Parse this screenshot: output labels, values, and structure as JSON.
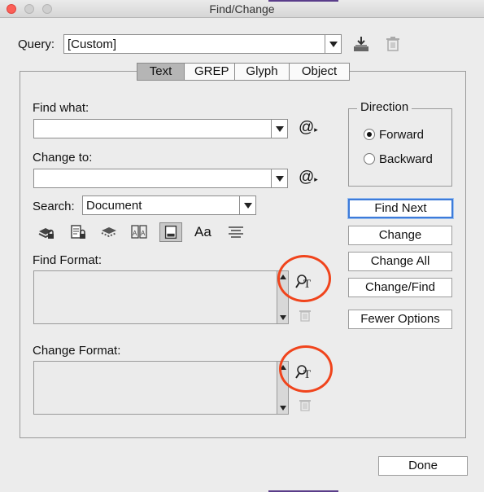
{
  "window": {
    "title": "Find/Change"
  },
  "query": {
    "label": "Query:",
    "value": "[Custom]"
  },
  "tabs": [
    {
      "label": "Text",
      "active": true
    },
    {
      "label": "GREP",
      "active": false
    },
    {
      "label": "Glyph",
      "active": false
    },
    {
      "label": "Object",
      "active": false
    }
  ],
  "find_what": {
    "label": "Find what:",
    "value": "",
    "special_char_icon": "@"
  },
  "change_to": {
    "label": "Change to:",
    "value": "",
    "special_char_icon": "@"
  },
  "search": {
    "label": "Search:",
    "value": "Document"
  },
  "search_options": {
    "icons": [
      "include-locked-layers-icon",
      "include-locked-stories-icon",
      "include-hidden-layers-icon",
      "include-master-pages-icon",
      "include-footnotes-icon",
      "case-sensitive-icon",
      "whole-word-icon"
    ],
    "case_label": "Aa"
  },
  "find_format": {
    "label": "Find Format:"
  },
  "change_format": {
    "label": "Change Format:"
  },
  "direction": {
    "legend": "Direction",
    "forward": "Forward",
    "backward": "Backward",
    "selected": "Forward"
  },
  "buttons": {
    "find_next": "Find Next",
    "change": "Change",
    "change_all": "Change All",
    "change_find": "Change/Find",
    "fewer_options": "Fewer Options",
    "done": "Done"
  },
  "colors": {
    "highlight_circle": "#f0441c",
    "default_button_border": "#3d7bd9"
  }
}
